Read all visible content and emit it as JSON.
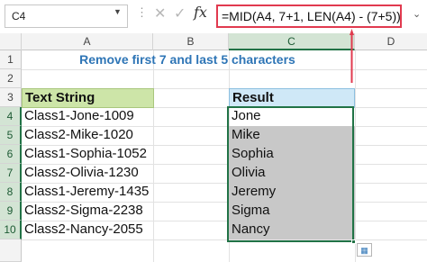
{
  "name_box": "C4",
  "formula": "=MID(A4, 7+1, LEN(A4) - (7+5))",
  "formula_bar_icons": [
    "cancel-icon",
    "enter-icon",
    "function-icon"
  ],
  "columns": [
    "A",
    "B",
    "C",
    "D"
  ],
  "rows": [
    "1",
    "2",
    "3",
    "4",
    "5",
    "6",
    "7",
    "8",
    "9",
    "10"
  ],
  "title": "Remove first 7 and last 5 characters",
  "table": {
    "header_text": "Text String",
    "header_result": "Result",
    "text_strings": [
      "Class1-Jone-1009",
      "Class2-Mike-1020",
      "Class1-Sophia-1052",
      "Class2-Olivia-1230",
      "Class1-Jeremy-1435",
      "Class2-Sigma-2238",
      "Class2-Nancy-2055"
    ],
    "results": [
      "Jone",
      "Mike",
      "Sophia",
      "Olivia",
      "Jeremy",
      "Sigma",
      "Nancy"
    ]
  },
  "colors": {
    "accent_green": "#217346",
    "title_blue": "#2e75b6",
    "header_green": "#cde5a8",
    "header_blue": "#cfe8f7",
    "formula_highlight": "#e13a4f"
  }
}
